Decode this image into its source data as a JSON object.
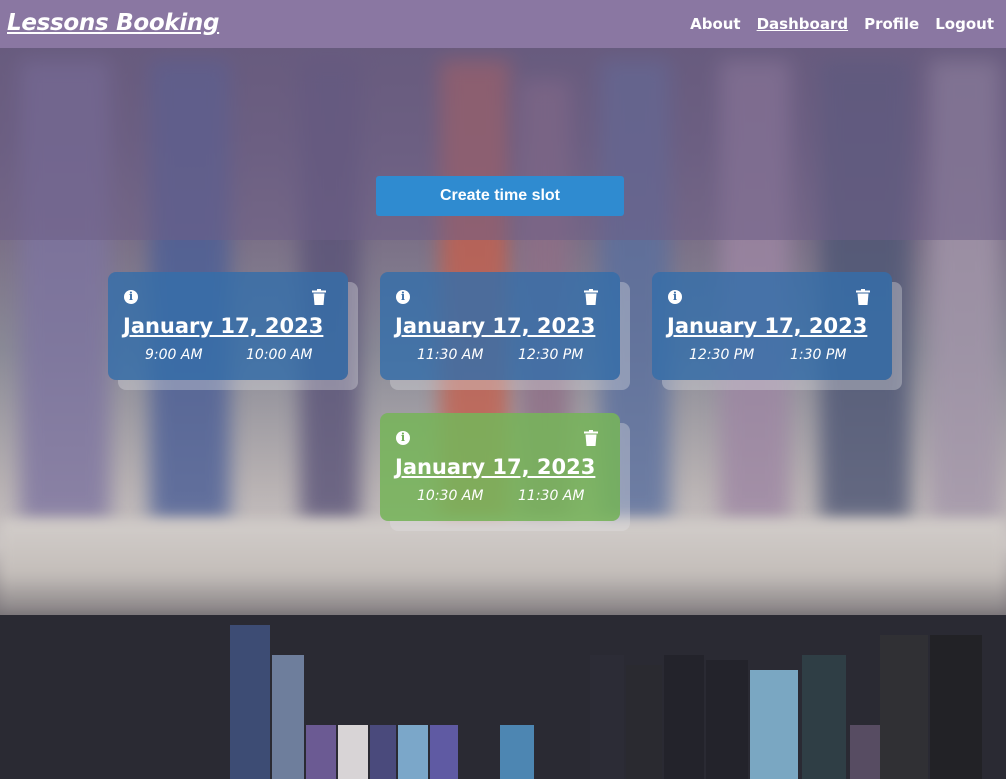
{
  "app": {
    "title": "Lessons Booking"
  },
  "nav": {
    "items": [
      {
        "label": "About"
      },
      {
        "label": "Dashboard"
      },
      {
        "label": "Profile"
      },
      {
        "label": "Logout"
      }
    ],
    "active": "Dashboard"
  },
  "actions": {
    "create_label": "Create time slot"
  },
  "slots": [
    {
      "date": "January 17, 2023",
      "start": "9:00 AM",
      "end": "10:00 AM",
      "color": "#346eaa",
      "status": "available"
    },
    {
      "date": "January 17, 2023",
      "start": "11:30 AM",
      "end": "12:30 PM",
      "color": "#346eaa",
      "status": "available"
    },
    {
      "date": "January 17, 2023",
      "start": "12:30 PM",
      "end": "1:30 PM",
      "color": "#346eaa",
      "status": "available"
    },
    {
      "date": "January 17, 2023",
      "start": "10:30 AM",
      "end": "11:30 AM",
      "color": "#76b45a",
      "status": "booked"
    }
  ],
  "icons": {
    "info": "info-icon",
    "delete": "trash-icon"
  },
  "colors": {
    "header": "#8a77a2",
    "button": "#2f8bd0",
    "card_blue": "#346eaa",
    "card_green": "#76b45a"
  }
}
